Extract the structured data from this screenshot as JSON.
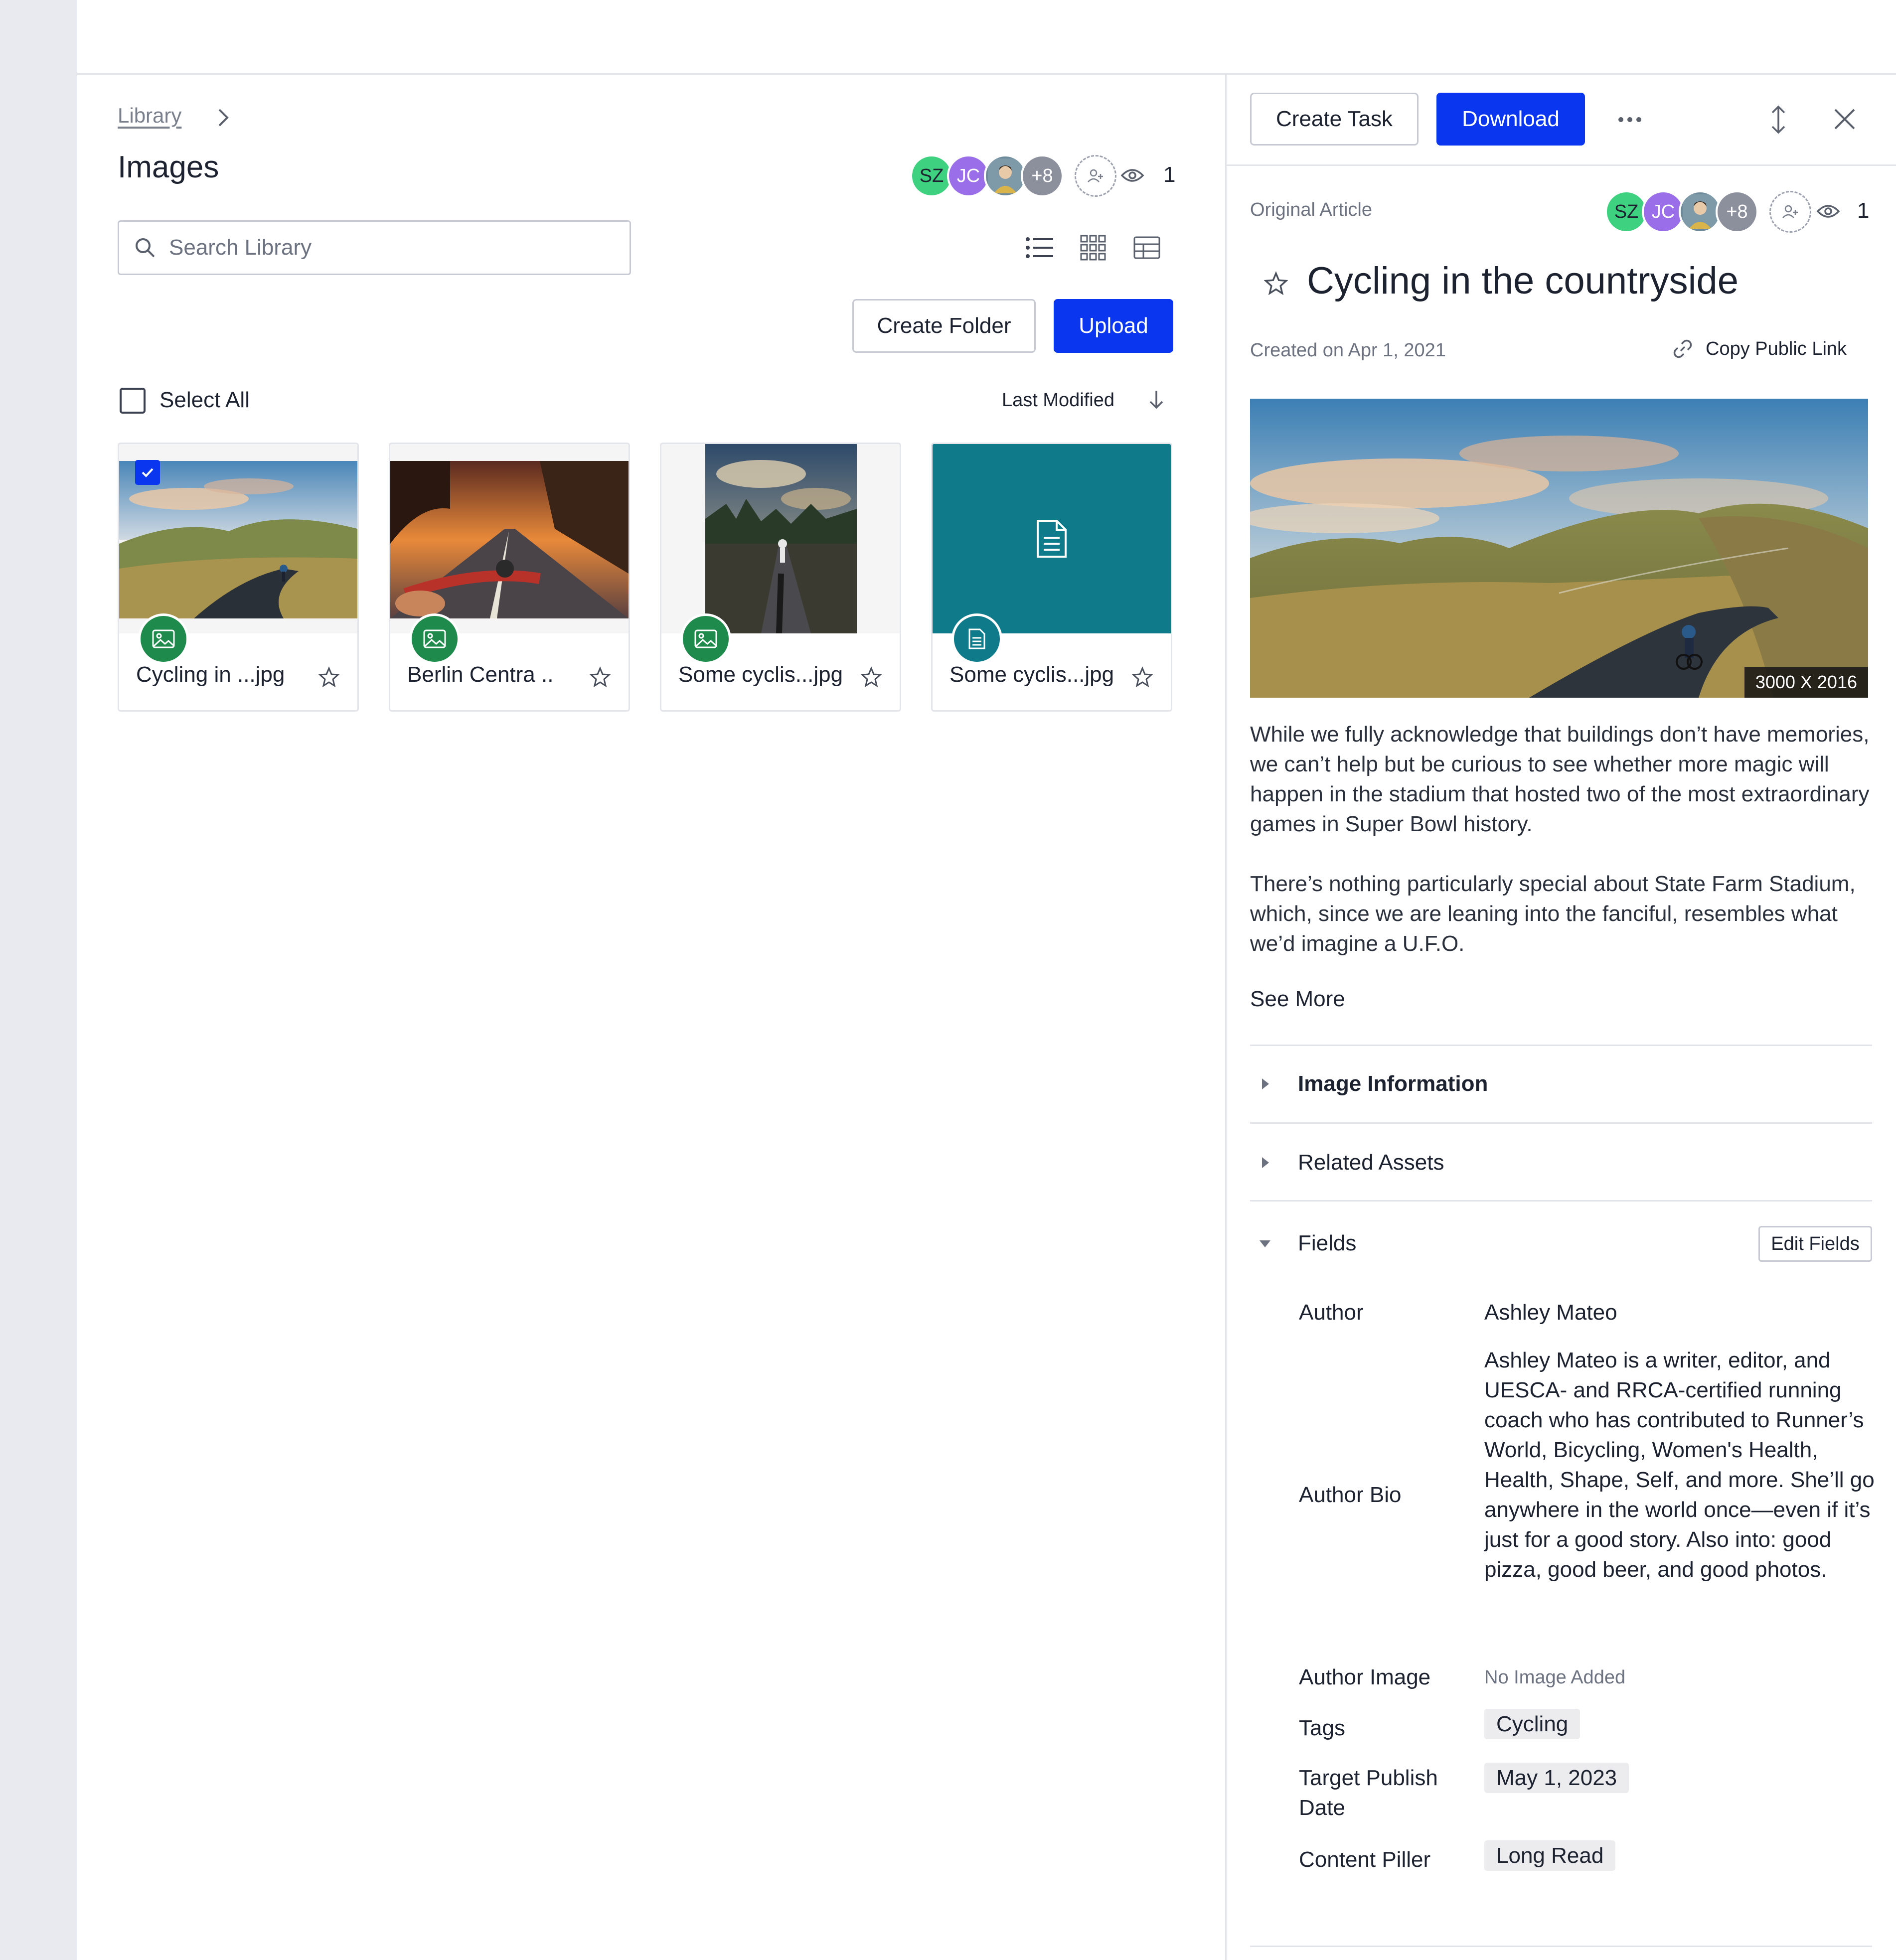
{
  "library": {
    "breadcrumb": "Library",
    "title": "Images",
    "collaborators": [
      "SZ",
      "JC",
      "+8"
    ],
    "viewer_count": "1",
    "search_placeholder": "Search Library",
    "create_folder_label": "Create Folder",
    "upload_label": "Upload",
    "select_all_label": "Select All",
    "sort_label": "Last Modified",
    "files": [
      {
        "name": "Cycling in ...jpg",
        "type": "image",
        "selected": true
      },
      {
        "name": "Berlin Centra ..",
        "type": "image",
        "selected": false
      },
      {
        "name": "Some cyclis...jpg",
        "type": "image",
        "selected": false
      },
      {
        "name": "Some cyclis...jpg",
        "type": "document",
        "selected": false
      }
    ]
  },
  "detail": {
    "create_task_label": "Create Task",
    "download_label": "Download",
    "section_label": "Original Article",
    "collaborators": [
      "SZ",
      "JC",
      "+8"
    ],
    "viewer_count": "1",
    "title": "Cycling in the countryside",
    "created": "Created on Apr 1, 2021",
    "copy_link_label": "Copy Public Link",
    "image_dimensions": "3000 X 2016",
    "body_p1": "While we fully acknowledge that buildings don’t have memories, we can’t help but be curious to see whether more magic will happen in the stadium that hosted two of the most extraordinary games in Super Bowl history.",
    "body_p2": "There’s nothing particularly special about State Farm Stadium, which, since we are leaning into the fanciful, resembles what we’d imagine a U.F.O.",
    "see_more_label": "See More",
    "sections": {
      "image_information": "Image Information",
      "related_assets": "Related Assets",
      "fields": "Fields"
    },
    "edit_fields_label": "Edit Fields",
    "fields": {
      "author_label": "Author",
      "author_value": "Ashley Mateo",
      "author_bio_label": "Author Bio",
      "author_bio_value": "Ashley Mateo is a writer, editor, and UESCA- and RRCA-certified running coach who has contributed to Runner’s World, Bicycling, Women's Health, Health, Shape, Self, and more. She’ll go anywhere in the world once—even if it’s just for a good story. Also into: good pizza, good beer, and good photos.",
      "author_image_label": "Author Image",
      "author_image_value": "No Image Added",
      "tags_label": "Tags",
      "tags_value": "Cycling",
      "target_publish_label": "Target Publish Date",
      "target_publish_value": "May 1, 2023",
      "content_piller_label": "Content Piller",
      "content_piller_value": "Long Read"
    }
  },
  "colors": {
    "primary": "#0a36f0",
    "avatar_sz": "#3ed17f",
    "avatar_jc": "#9a6ee8",
    "image_badge": "#1e8a4c",
    "document_tile": "#0e7a8a"
  }
}
